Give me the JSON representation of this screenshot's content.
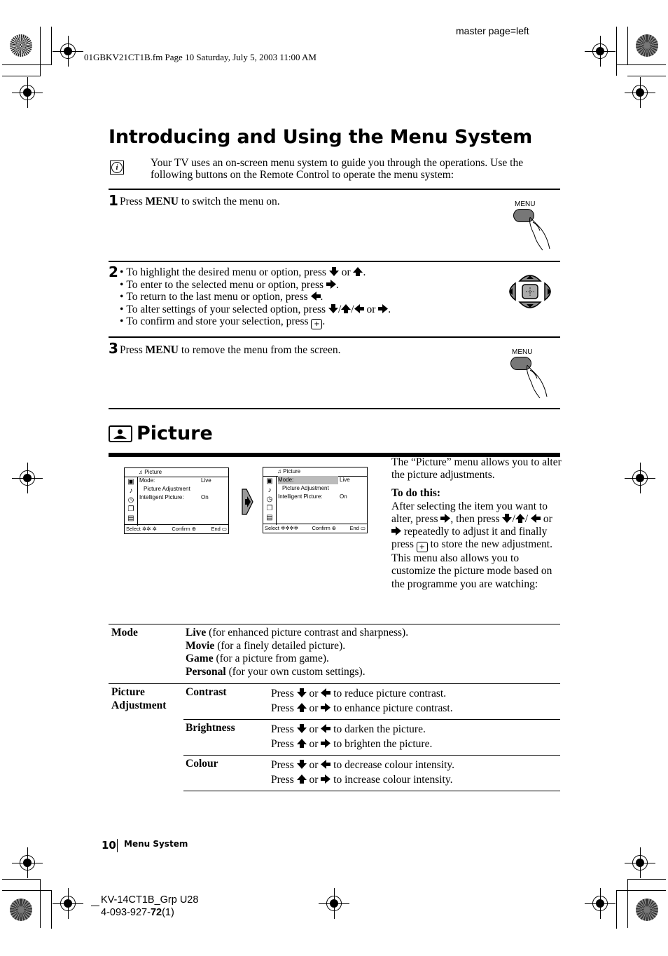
{
  "print_meta": {
    "file_stamp": "01GBKV21CT1B.fm  Page 10  Saturday, July 5, 2003  11:00 AM",
    "master_page": "master page=left",
    "model_line": "KV-14CT1B_Grp U28",
    "part_prefix": "4-093-927-",
    "part_bold": "72",
    "part_suffix": "(1)"
  },
  "title": "Introducing and Using the Menu System",
  "intro": {
    "icon": "info-icon",
    "text": "Your TV uses an on-screen menu system to guide you through the operations. Use the following buttons on the Remote Control to operate the menu system:"
  },
  "steps": [
    {
      "num": "1",
      "pre": "Press ",
      "key": "MENU",
      "post": " to switch the menu on.",
      "illustration_label": "MENU"
    },
    {
      "num": "2",
      "bullets": [
        {
          "text": "To highlight the desired menu or option, press ",
          "keys": [
            "down",
            "or",
            "up"
          ],
          "end": "."
        },
        {
          "text": "To enter to the selected menu or option, press ",
          "keys": [
            "right"
          ],
          "end": "."
        },
        {
          "text": "To return to the last menu or option, press ",
          "keys": [
            "left"
          ],
          "end": "."
        },
        {
          "text": "To alter settings of your selected option, press ",
          "keys": [
            "down",
            "/",
            "up",
            "/",
            "left",
            "or",
            "right"
          ],
          "end": "."
        },
        {
          "text": "To confirm and store your selection, press ",
          "keys": [
            "ok"
          ],
          "end": "."
        }
      ]
    },
    {
      "num": "3",
      "pre": "Press ",
      "key": "MENU",
      "post": " to remove the menu from the screen.",
      "illustration_label": "MENU"
    }
  ],
  "picture_section": {
    "heading": "Picture",
    "osd_before": {
      "title": "Picture",
      "rows": [
        {
          "label": "Mode:",
          "value": "Live"
        },
        {
          "label": "  Picture Adjustment",
          "value": ""
        },
        {
          "label": "Intelligent Picture:",
          "value": "On"
        }
      ],
      "footer": {
        "select": "Select",
        "confirm": "Confirm",
        "end": "End"
      }
    },
    "osd_after": {
      "title": "Picture",
      "rows": [
        {
          "label": "Mode:",
          "value": "Live",
          "highlighted": true
        },
        {
          "label": "  Picture Adjustment",
          "value": ""
        },
        {
          "label": "Intelligent Picture:",
          "value": "On"
        }
      ],
      "footer": {
        "select": "Select",
        "confirm": "Confirm",
        "end": "End"
      }
    },
    "description": {
      "p1": "The “Picture” menu allows you to alter the picture adjustments.",
      "todo_heading": "To do this:",
      "p2_a": "After selecting the item you want to alter, press ",
      "p2_b": ", then press ",
      "p2_c": " repeatedly to adjust it and finally press ",
      "p2_d": " to store the new adjustment.",
      "p3": "This menu also allows you to customize the picture mode based on the programme you are watching:"
    },
    "table": {
      "mode": {
        "label": "Mode",
        "options": [
          {
            "name": "Live",
            "desc": " (for enhanced picture contrast and sharpness)."
          },
          {
            "name": "Movie",
            "desc": " (for a finely detailed picture)."
          },
          {
            "name": "Game",
            "desc": " (for a picture from game)."
          },
          {
            "name": "Personal",
            "desc": " (for your own custom settings)."
          }
        ]
      },
      "adjustment": {
        "label_line1": "Picture",
        "label_line2": "Adjustment",
        "items": [
          {
            "name": "Contrast",
            "line1": "to reduce picture contrast.",
            "line2": "to enhance picture contrast."
          },
          {
            "name": "Brightness",
            "line1": "to darken the picture.",
            "line2": "to brighten the picture."
          },
          {
            "name": "Colour",
            "line1": "to decrease colour intensity.",
            "line2": "to increase colour intensity."
          }
        ],
        "press_word": "Press",
        "or_word": "or"
      }
    }
  },
  "footer": {
    "page_number": "10",
    "section": "Menu System"
  }
}
